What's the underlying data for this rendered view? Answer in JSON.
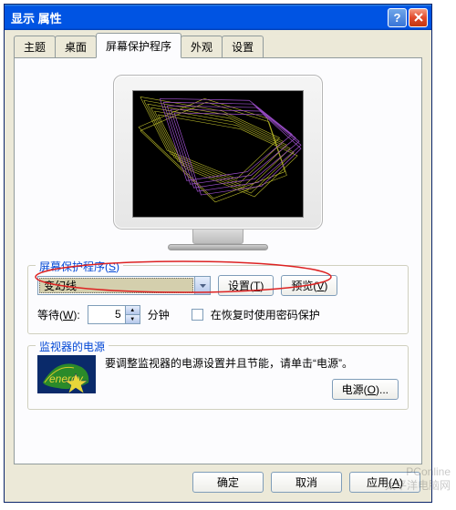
{
  "window": {
    "title": "显示 属性"
  },
  "tabs": {
    "items": [
      {
        "label": "主题"
      },
      {
        "label": "桌面"
      },
      {
        "label": "屏幕保护程序"
      },
      {
        "label": "外观"
      },
      {
        "label": "设置"
      }
    ],
    "active_index": 2
  },
  "screensaver_section": {
    "legend": "屏幕保护程序",
    "legend_hotkey": "S",
    "selected": "变幻线",
    "settings_btn": "设置",
    "settings_hotkey": "T",
    "preview_btn": "预览",
    "preview_hotkey": "V",
    "wait_label": "等待",
    "wait_hotkey": "W",
    "wait_value": "5",
    "wait_unit": "分钟",
    "password_checkbox": "在恢复时使用密码保护",
    "password_checked": false
  },
  "power_section": {
    "legend": "监视器的电源",
    "text": "要调整监视器的电源设置并且节能，请单击“电源”。",
    "power_btn": "电源",
    "power_hotkey": "O"
  },
  "dialog_buttons": {
    "ok": "确定",
    "cancel": "取消",
    "apply": "应用",
    "apply_hotkey": "A"
  },
  "watermark": {
    "line1": "PConline",
    "line2": "太平洋电脑网"
  }
}
